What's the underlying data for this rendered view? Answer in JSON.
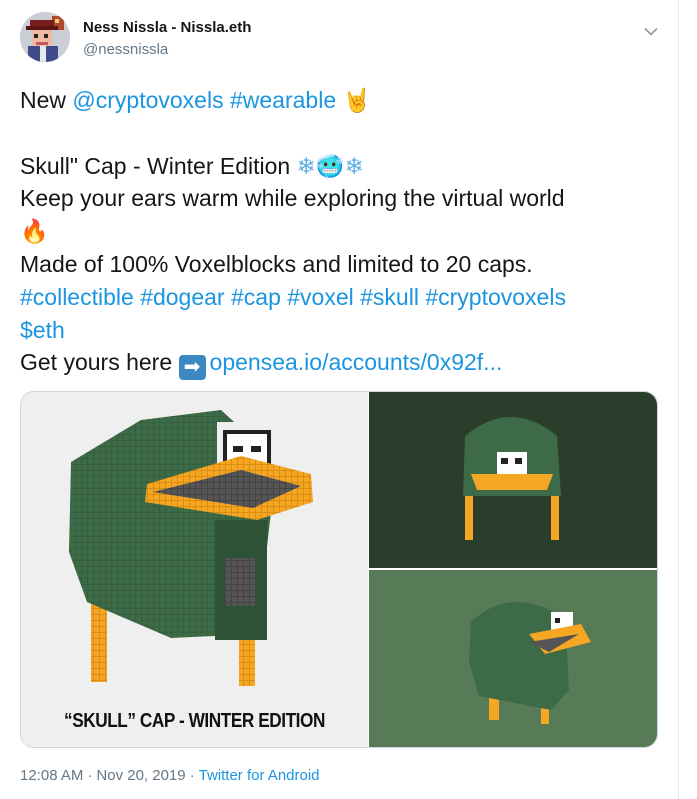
{
  "author": {
    "display_name": "Ness Nissla - Nissla.eth",
    "handle": "@nessnissla",
    "avatar_icon": "pixel-avatar-icon"
  },
  "tweet_text": {
    "l1_prefix": "New ",
    "l1_mention": "@cryptovoxels",
    "l1_space": " ",
    "l1_hashtag": "#wearable",
    "l1_space2": " ",
    "l1_emoji": "🤘",
    "l2_text": "Skull\" Cap - Winter Edition ",
    "l2_emoji1": "❄",
    "l2_emoji2": "🥶",
    "l2_emoji3": "❄",
    "l3_text": "Keep your ears warm while exploring the virtual world",
    "l4_emoji": "🔥",
    "l5_text": "Made of 100% Voxelblocks and limited to 20 caps.",
    "hashtags": [
      "#collectible",
      "#dogear",
      "#cap",
      "#voxel",
      "#skull",
      "#cryptovoxels"
    ],
    "cashtag": "$eth",
    "l8_text": "Get yours here ",
    "l8_arrow": "➡",
    "l8_link": "opensea.io/accounts/0x92f..."
  },
  "media": {
    "caption": "“SKULL” CAP - WINTER EDITION",
    "colors": {
      "cap_green": "#3e6b47",
      "cap_dark": "#2e5236",
      "visor_orange": "#f5a623",
      "panel_dark_bg": "#2b3d2b",
      "panel_light_bg": "#577a57"
    }
  },
  "footer": {
    "time": "12:08 AM",
    "dot": "·",
    "date": "Nov 20, 2019",
    "dot2": "·",
    "source": "Twitter for Android"
  },
  "icons": {
    "more_menu": "chevron-down-icon"
  }
}
